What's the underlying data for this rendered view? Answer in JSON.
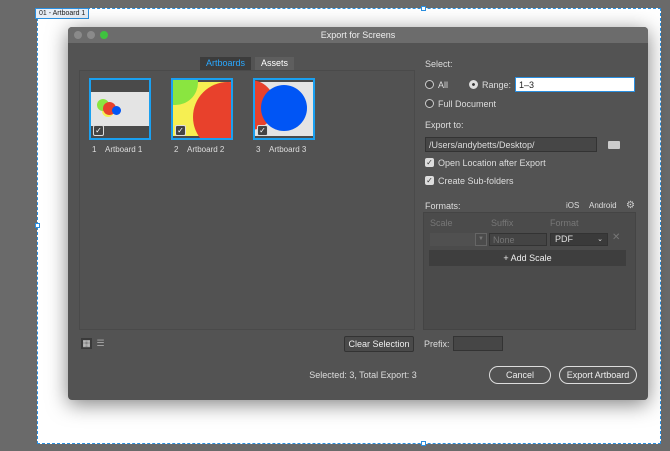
{
  "artboard_label": "01 - Artboard 1",
  "dialog": {
    "title": "Export for Screens"
  },
  "tabs": [
    {
      "label": "Artboards",
      "active": true
    },
    {
      "label": "Assets",
      "active": false
    }
  ],
  "artboards": [
    {
      "num": "1",
      "name": "Artboard 1",
      "checked": true
    },
    {
      "num": "2",
      "name": "Artboard 2",
      "checked": true
    },
    {
      "num": "3",
      "name": "Artboard 3",
      "checked": true
    }
  ],
  "select": {
    "label": "Select:",
    "all": "All",
    "range": "Range:",
    "range_value": "1–3",
    "full_document": "Full Document"
  },
  "export_to": {
    "label": "Export to:",
    "path": "/Users/andybetts/Desktop/",
    "open_location": "Open Location after Export",
    "create_subfolders": "Create Sub-folders"
  },
  "formats": {
    "label": "Formats:",
    "ios": "iOS",
    "android": "Android",
    "headers": [
      "Scale",
      "Suffix",
      "Format"
    ],
    "suffix_placeholder": "None",
    "format_value": "PDF",
    "add_scale": "+ Add Scale"
  },
  "bottom": {
    "clear_selection": "Clear Selection",
    "prefix_label": "Prefix:",
    "prefix_value": "",
    "status": "Selected: 3, Total Export: 3",
    "cancel": "Cancel",
    "export": "Export Artboard"
  },
  "colors": {
    "accent": "#1aa0f0",
    "red": "#e8412c",
    "green": "#8ae540",
    "yellow": "#f6ef52",
    "blue": "#0055f5"
  }
}
